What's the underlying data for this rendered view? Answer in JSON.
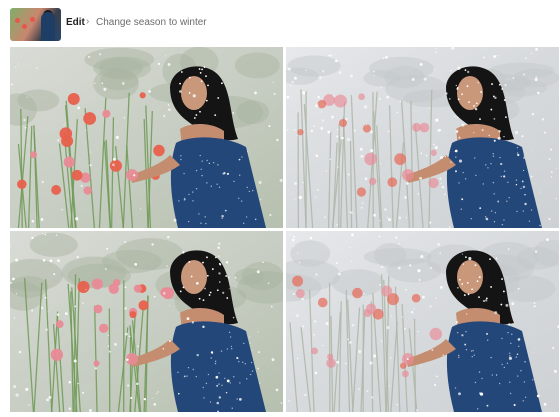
{
  "breadcrumb": {
    "root_label": "Edit",
    "separator": "›",
    "current_label": "Change season to winter"
  },
  "results": [
    {
      "variant": "warm-color",
      "snow": "light"
    },
    {
      "variant": "desaturated",
      "snow": "heavy"
    },
    {
      "variant": "warm-color",
      "snow": "medium"
    },
    {
      "variant": "desaturated",
      "snow": "medium"
    }
  ],
  "colors": {
    "dress": "#24477a",
    "hair": "#141414",
    "flower_warm": "#e8604c",
    "flower_pink": "#e98a96",
    "stem_warm": "#6f9a56",
    "stem_cold": "#aeb8a8"
  }
}
